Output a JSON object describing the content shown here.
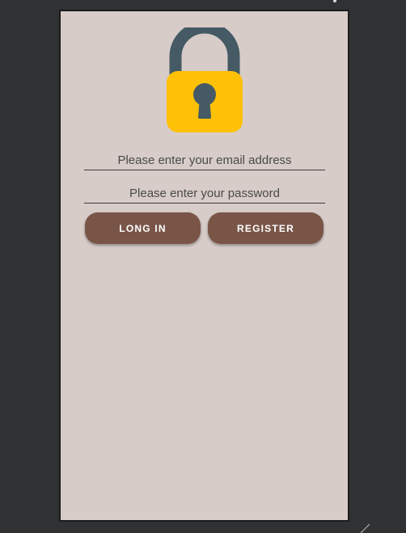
{
  "app": {
    "lock_icon": "padlock-icon",
    "colors": {
      "screen_background": "#d7ccc8",
      "lock_body": "#ffc107",
      "lock_shackle": "#455a64",
      "button": "#795548",
      "button_text": "#ffffff",
      "desktop_background": "#303133"
    }
  },
  "form": {
    "email_placeholder": "Please enter your email address",
    "email_value": "",
    "password_placeholder": "Please enter your password",
    "password_value": ""
  },
  "buttons": {
    "login_label": "LONG IN",
    "register_label": "REGISTER"
  }
}
